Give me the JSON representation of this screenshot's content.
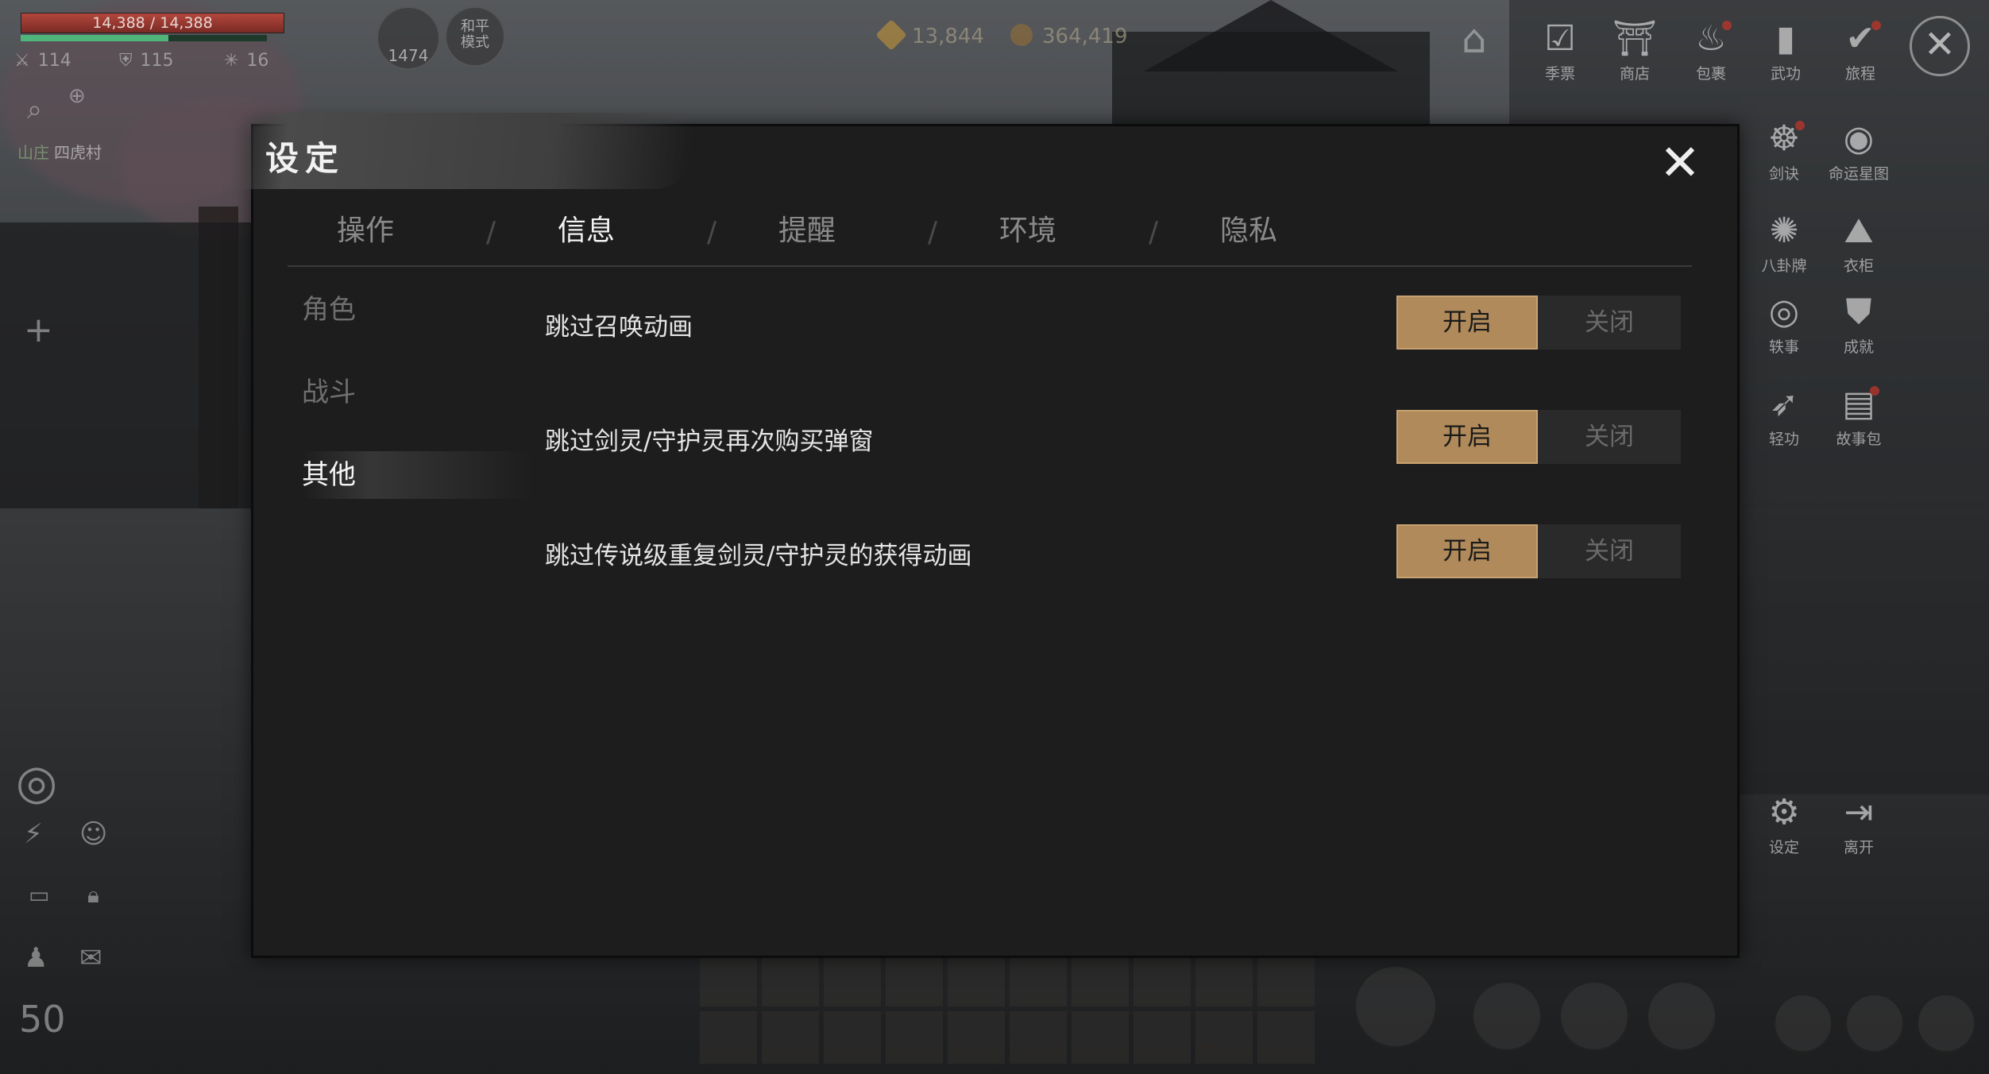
{
  "hud": {
    "hp_text": "14,388 / 14,388",
    "hp_fraction": 1.0,
    "stat1": "114",
    "stat2": "115",
    "stat3": "16",
    "power": "1474",
    "mode_label": "和平\n模式",
    "location_badge": "山庄",
    "location_name": "四虎村",
    "level": "50"
  },
  "currency": {
    "gold": "13,844",
    "coins": "364,419"
  },
  "right_menu": {
    "row1": [
      {
        "label": "季票",
        "icon": "calendar-check-icon",
        "dot": false
      },
      {
        "label": "商店",
        "icon": "shop-icon",
        "dot": false
      },
      {
        "label": "包裹",
        "icon": "bag-icon",
        "dot": true
      },
      {
        "label": "武功",
        "icon": "book-icon",
        "dot": false
      },
      {
        "label": "旅程",
        "icon": "journey-icon",
        "dot": true
      }
    ],
    "col": [
      {
        "label": "剑诀",
        "icon": "meditate-icon",
        "dot": true
      },
      {
        "label": "命运星图",
        "icon": "swirl-icon",
        "dot": false
      },
      {
        "label": "八卦牌",
        "icon": "bagua-icon",
        "dot": false
      },
      {
        "label": "衣柜",
        "icon": "wardrobe-icon",
        "dot": false
      },
      {
        "label": "轶事",
        "icon": "anecdote-icon",
        "dot": false
      },
      {
        "label": "成就",
        "icon": "achievement-icon",
        "dot": false
      },
      {
        "label": "轻功",
        "icon": "wing-icon",
        "dot": false
      },
      {
        "label": "故事包",
        "icon": "storybook-icon",
        "dot": true
      },
      {
        "label": "设定",
        "icon": "gear-icon",
        "dot": false
      },
      {
        "label": "离开",
        "icon": "exit-icon",
        "dot": false
      }
    ]
  },
  "dialog": {
    "title": "设定",
    "close_glyph": "✕",
    "tabs": [
      "操作",
      "信息",
      "提醒",
      "环境",
      "隐私"
    ],
    "active_tab": 1,
    "sidebar": [
      "角色",
      "战斗",
      "其他"
    ],
    "active_side": 2,
    "settings": [
      {
        "label": "跳过召唤动画",
        "on": "开启",
        "off": "关闭",
        "value": "on"
      },
      {
        "label": "跳过剑灵/守护灵再次购买弹窗",
        "on": "开启",
        "off": "关闭",
        "value": "on"
      },
      {
        "label": "跳过传说级重复剑灵/守护灵的获得动画",
        "on": "开启",
        "off": "关闭",
        "value": "on"
      }
    ]
  },
  "colors": {
    "toggle_on": "#b08a5a",
    "toggle_off": "#2a2a2a",
    "dialog_bg": "#1d1d1e",
    "hp": "#b3473d",
    "notification_dot": "#c2362b"
  }
}
